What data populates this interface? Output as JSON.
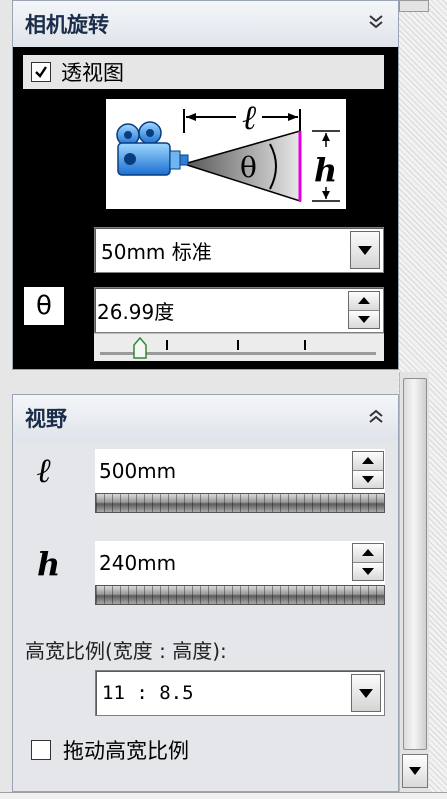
{
  "camera_rotation": {
    "title": "相机旋转",
    "perspective_checkbox": {
      "label": "透视图",
      "checked": true
    },
    "lens_dropdown": {
      "value": "50mm 标准"
    },
    "angle": {
      "symbol": "θ",
      "value": "26.99度"
    }
  },
  "field_of_view": {
    "title": "视野",
    "length": {
      "symbol": "ℓ",
      "value": "500mm"
    },
    "height": {
      "symbol": "h",
      "value": "240mm"
    },
    "aspect_label": "高宽比例(宽度 : 高度):",
    "aspect_dropdown": {
      "value": "11 : 8.5"
    },
    "drag_aspect_checkbox": {
      "label": "拖动高宽比例",
      "checked": false
    }
  },
  "diagram": {
    "length_label": "ℓ",
    "angle_label": "θ",
    "height_label": "h"
  },
  "colors": {
    "header_text": "#1b2d4a",
    "accent_line": "#e000e0",
    "panel_bg": "#000000"
  },
  "icons": [
    "chevron-double-down-icon",
    "chevron-double-up-icon",
    "dropdown-arrow-icon",
    "spinner-up-icon",
    "spinner-down-icon",
    "camera-icon"
  ]
}
